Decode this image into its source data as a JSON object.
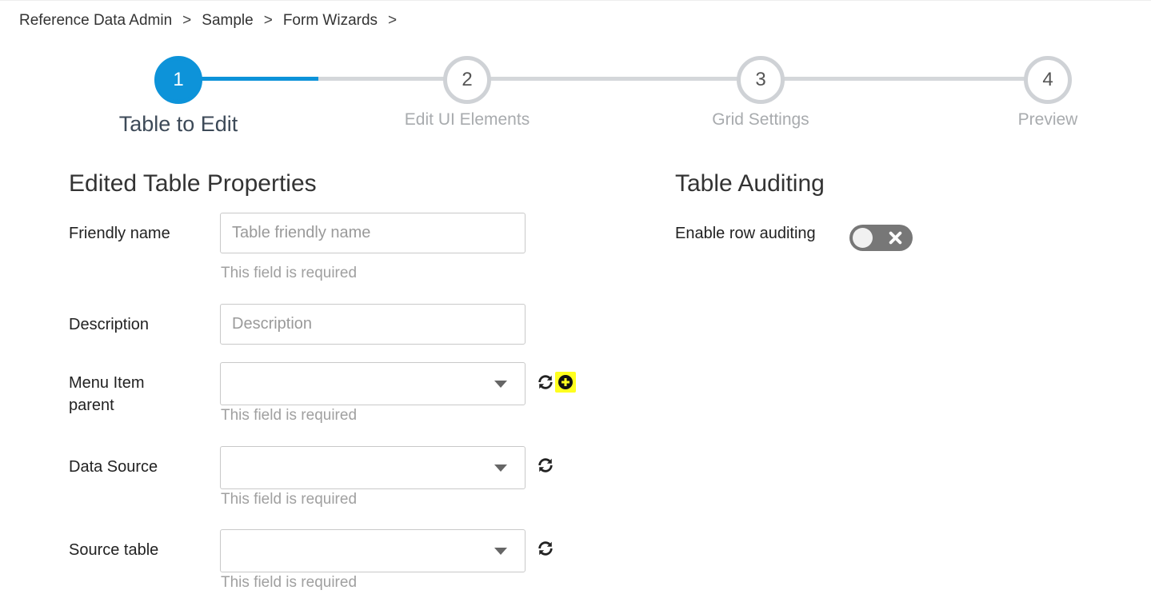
{
  "breadcrumb": {
    "items": [
      "Reference Data Admin",
      "Sample",
      "Form Wizards"
    ],
    "separator": ">"
  },
  "wizard": {
    "accent_color": "#0d93d9",
    "current_step": 1,
    "steps": [
      {
        "number": "1",
        "label": "Table to Edit"
      },
      {
        "number": "2",
        "label": "Edit UI Elements"
      },
      {
        "number": "3",
        "label": "Grid Settings"
      },
      {
        "number": "4",
        "label": "Preview"
      }
    ]
  },
  "properties": {
    "title": "Edited Table Properties",
    "friendly_name": {
      "label": "Friendly name",
      "value": "",
      "placeholder": "Table friendly name",
      "help": "This field is required"
    },
    "description": {
      "label": "Description",
      "value": "",
      "placeholder": "Description"
    },
    "menu_item_parent": {
      "label_line1": "Menu Item",
      "label_line2": "parent",
      "value": "",
      "help": "This field is required"
    },
    "data_source": {
      "label": "Data Source",
      "value": "",
      "help": "This field is required"
    },
    "source_table": {
      "label": "Source table",
      "value": "",
      "help": "This field is required"
    }
  },
  "auditing": {
    "title": "Table Auditing",
    "enable_row_auditing": {
      "label": "Enable row auditing",
      "enabled": false
    }
  },
  "icons": {
    "refresh": "refresh-icon",
    "add": "plus-circle-icon",
    "toggle_off": "close-icon"
  }
}
